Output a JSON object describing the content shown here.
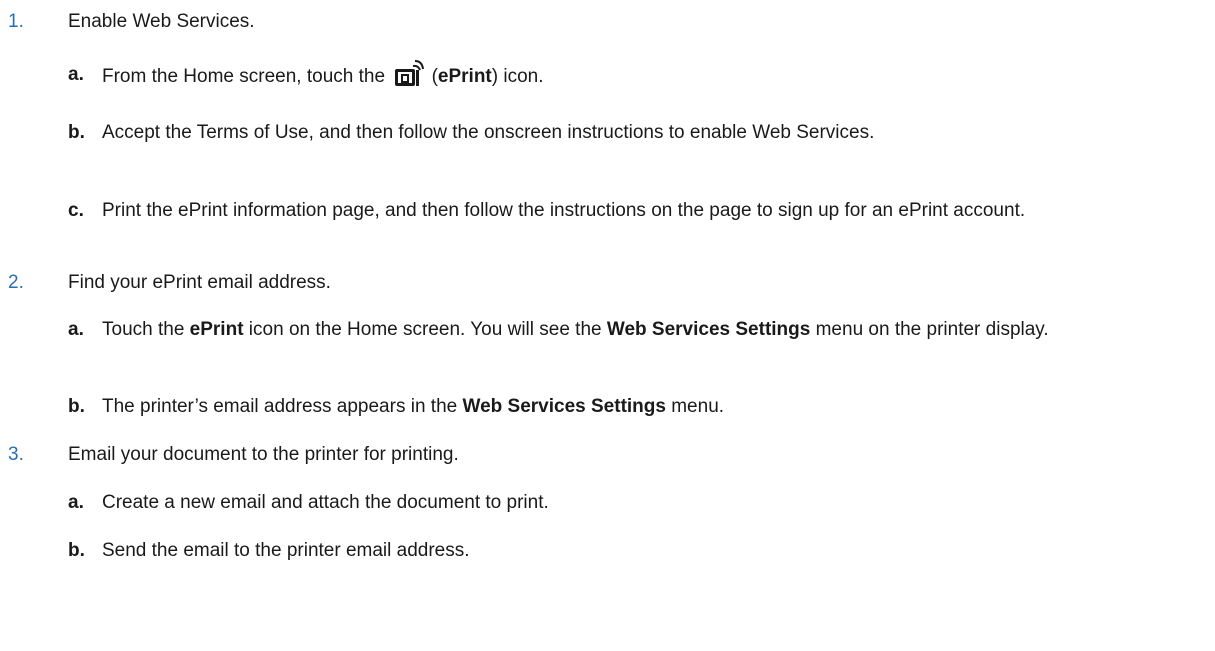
{
  "steps": [
    {
      "number": "1.",
      "text": "Enable Web Services.",
      "subs": [
        {
          "letter": "a.",
          "pre": "From the Home screen, touch the",
          "icon": "eprint-icon",
          "mid_open": " (",
          "bold": "ePrint",
          "post": ") icon."
        },
        {
          "letter": "b.",
          "text": "Accept the Terms of Use, and then follow the onscreen instructions to enable Web Services."
        },
        {
          "letter": "c.",
          "text": "Print the ePrint information page, and then follow the instructions on the page to sign up for an ePrint account."
        }
      ]
    },
    {
      "number": "2.",
      "text": "Find your ePrint email address.",
      "subs": [
        {
          "letter": "a.",
          "pre": "Touch the ",
          "bold1": "ePrint",
          "mid": " icon on the Home screen. You will see the ",
          "bold2": "Web Services Settings",
          "post": " menu on the printer display."
        },
        {
          "letter": "b.",
          "pre": "The printer’s email address appears in the ",
          "bold": "Web Services Settings",
          "post": " menu."
        }
      ]
    },
    {
      "number": "3.",
      "text": "Email your document to the printer for printing.",
      "subs": [
        {
          "letter": "a.",
          "text": "Create a new email and attach the document to print."
        },
        {
          "letter": "b.",
          "text": "Send the email to the printer email address."
        }
      ]
    }
  ],
  "colors": {
    "step_number": "#2a6fb3",
    "text": "#1a1a1a"
  }
}
